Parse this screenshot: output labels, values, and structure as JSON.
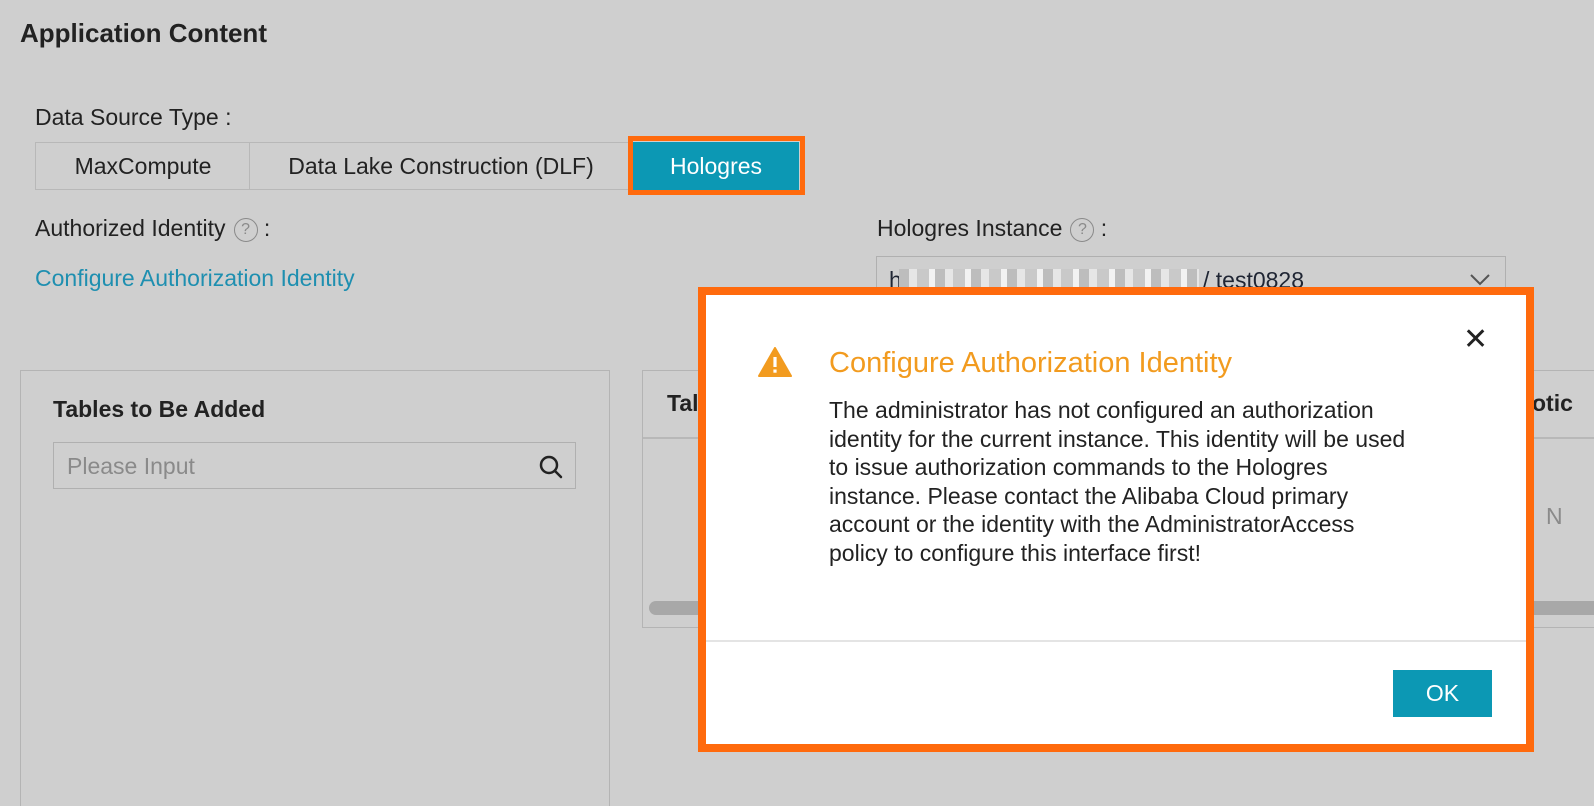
{
  "page": {
    "title": "Application Content"
  },
  "data_source": {
    "label": "Data Source Type :",
    "options": [
      "MaxCompute",
      "Data Lake Construction (DLF)",
      "Hologres"
    ],
    "selected": "Hologres"
  },
  "auth": {
    "label": "Authorized Identity",
    "colon": ":",
    "help": "?",
    "link": "Configure Authorization Identity"
  },
  "instance": {
    "label": "Hologres Instance",
    "colon": ":",
    "help": "?",
    "prefix": "h",
    "value": "/ test0828"
  },
  "tables": {
    "title": "Tables to Be Added",
    "search_placeholder": "Please Input"
  },
  "right_panel": {
    "header_left": "Tal",
    "header_right": "otic",
    "cell": "N"
  },
  "modal": {
    "title": "Configure Authorization Identity",
    "body": "The administrator has not configured an authorization identity for the current instance. This identity will be used to issue authorization commands to the Hologres instance. Please contact the Alibaba Cloud primary account or the identity with the AdministratorAccess policy to configure this interface first!",
    "ok_label": "OK",
    "close_symbol": "✕"
  },
  "colors": {
    "accent": "#0c98b4",
    "highlight": "#ff6a0d",
    "warning": "#f29b1f",
    "link": "#1e8fb0"
  }
}
